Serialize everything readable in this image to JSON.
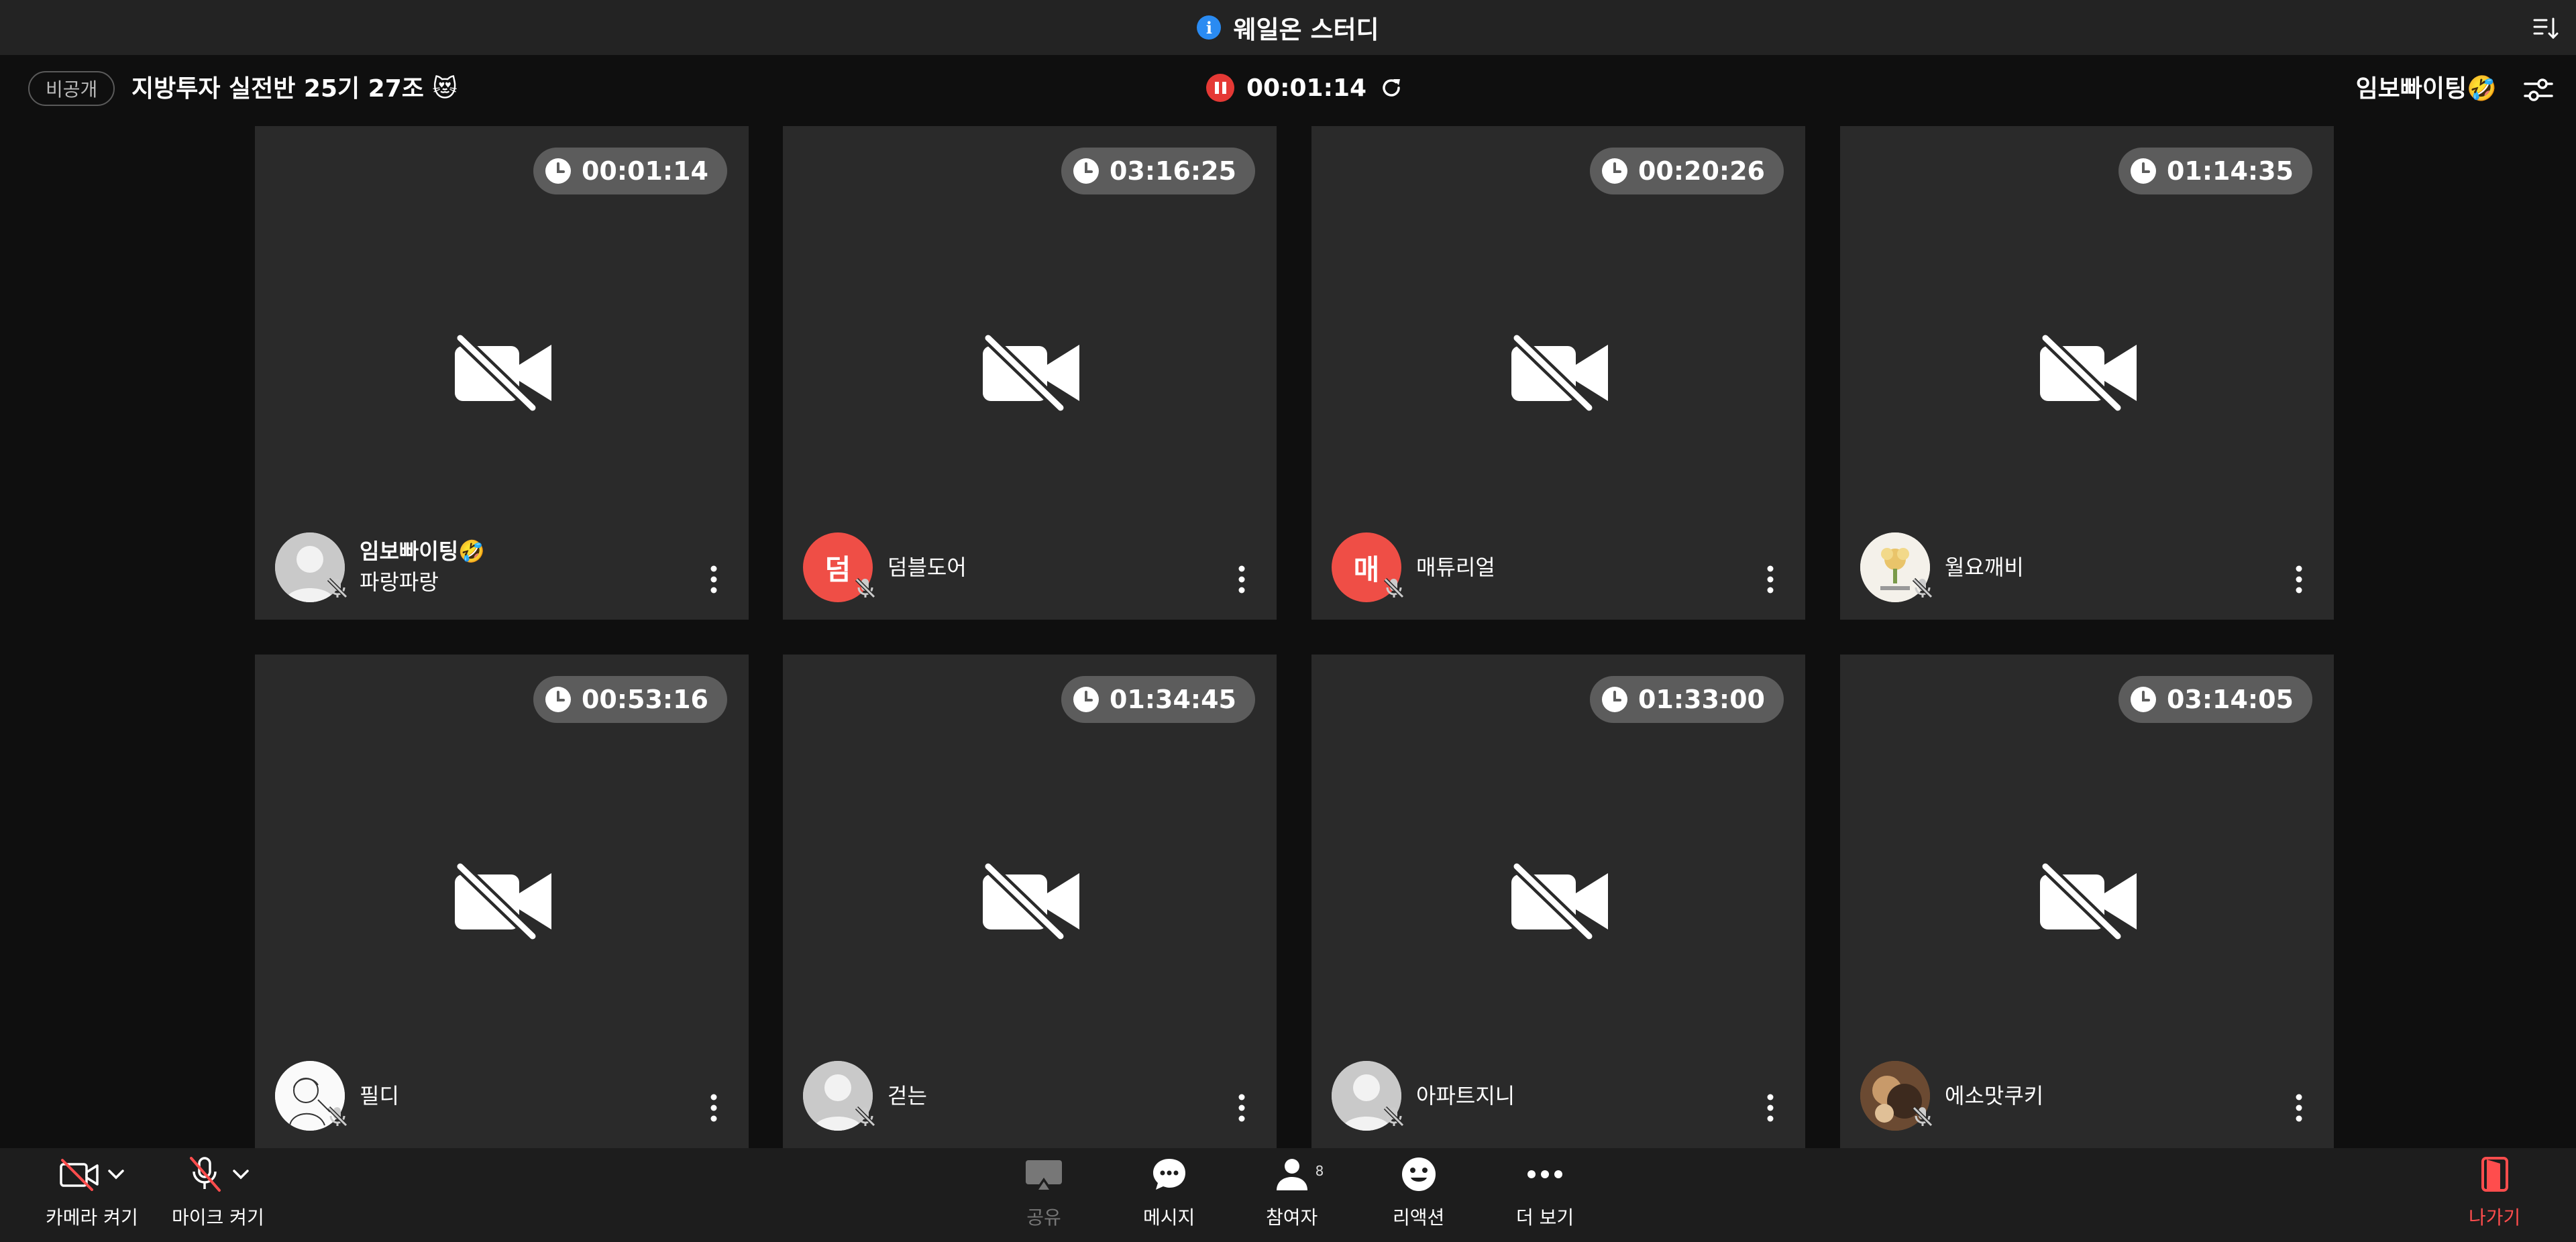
{
  "window": {
    "title": "웨일온 스터디"
  },
  "header": {
    "private_badge": "비공개",
    "room_name": "지방투자 실전반 25기 27조 😻",
    "elapsed": "00:01:14",
    "current_user": "임보빠이팅🤣"
  },
  "tiles": [
    {
      "duration": "00:01:14",
      "name": "임보빠이팅🤣",
      "subname": "파랑파랑",
      "avatar": "silhouette"
    },
    {
      "duration": "03:16:25",
      "name": "덤블도어",
      "avatar_initial": "덤"
    },
    {
      "duration": "00:20:26",
      "name": "매튜리얼",
      "avatar_initial": "매"
    },
    {
      "duration": "01:14:35",
      "name": "월요깨비",
      "avatar": "flower"
    },
    {
      "duration": "00:53:16",
      "name": "필디",
      "avatar": "sketch"
    },
    {
      "duration": "01:34:45",
      "name": "걷는",
      "avatar": "silhouette"
    },
    {
      "duration": "01:33:00",
      "name": "아파트지니",
      "avatar": "silhouette"
    },
    {
      "duration": "03:14:05",
      "name": "에소맛쿠키",
      "avatar": "photo"
    }
  ],
  "toolbar": {
    "camera": "카메라 켜기",
    "mic": "마이크 켜기",
    "share": "공유",
    "message": "메시지",
    "participants": "참여자",
    "participants_count": "8",
    "reaction": "리액션",
    "more": "더 보기",
    "leave": "나가기"
  },
  "colors": {
    "record": "#e53935",
    "leave": "#ff4d4d",
    "info": "#2a8bf2",
    "avatar_red": "#ef4e46"
  }
}
